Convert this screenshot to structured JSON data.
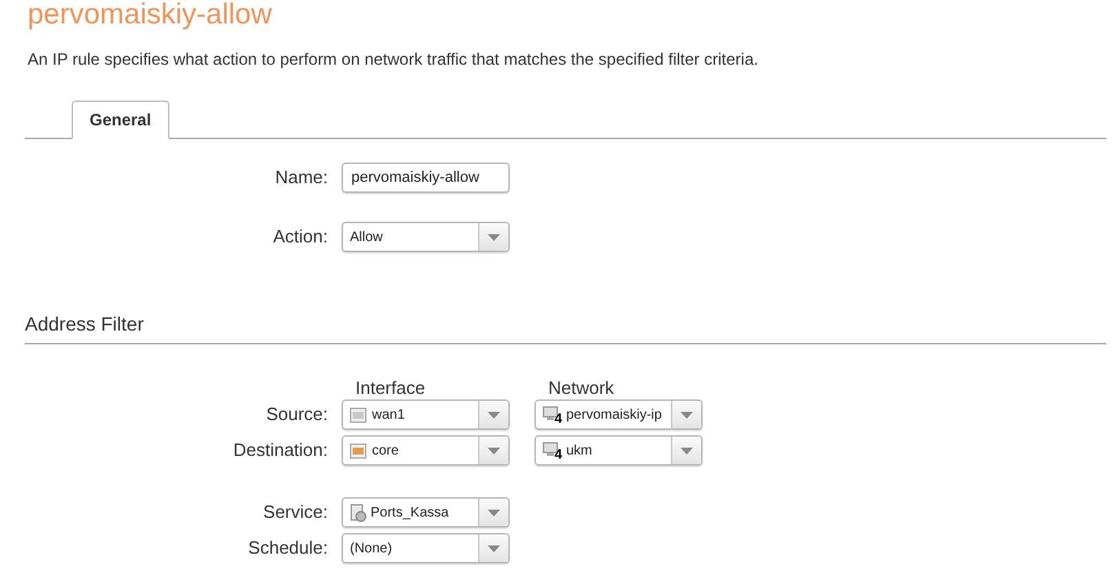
{
  "title": "pervomaiskiy-allow",
  "description": "An IP rule specifies what action to perform on network traffic that matches the specified filter criteria.",
  "tabs": [
    {
      "label": "General",
      "selected": true
    }
  ],
  "name_field": {
    "label": "Name:",
    "value": "pervomaiskiy-allow"
  },
  "action_field": {
    "label": "Action:",
    "value": "Allow"
  },
  "address_filter": {
    "heading": "Address Filter",
    "columns": [
      "Interface",
      "Network"
    ],
    "rows": [
      {
        "label": "Source:",
        "interface": {
          "value": "wan1",
          "kind": "port"
        },
        "network": {
          "value": "pervomaiskiy-ip",
          "badge": "4"
        }
      },
      {
        "label": "Destination:",
        "interface": {
          "value": "core",
          "kind": "active-port"
        },
        "network": {
          "value": "ukm",
          "badge": "4"
        }
      }
    ]
  },
  "service_rows": [
    {
      "label": "Service:",
      "value": "Ports_Kassa",
      "kind": "service"
    },
    {
      "label": "Schedule:",
      "value": "(None)"
    }
  ]
}
